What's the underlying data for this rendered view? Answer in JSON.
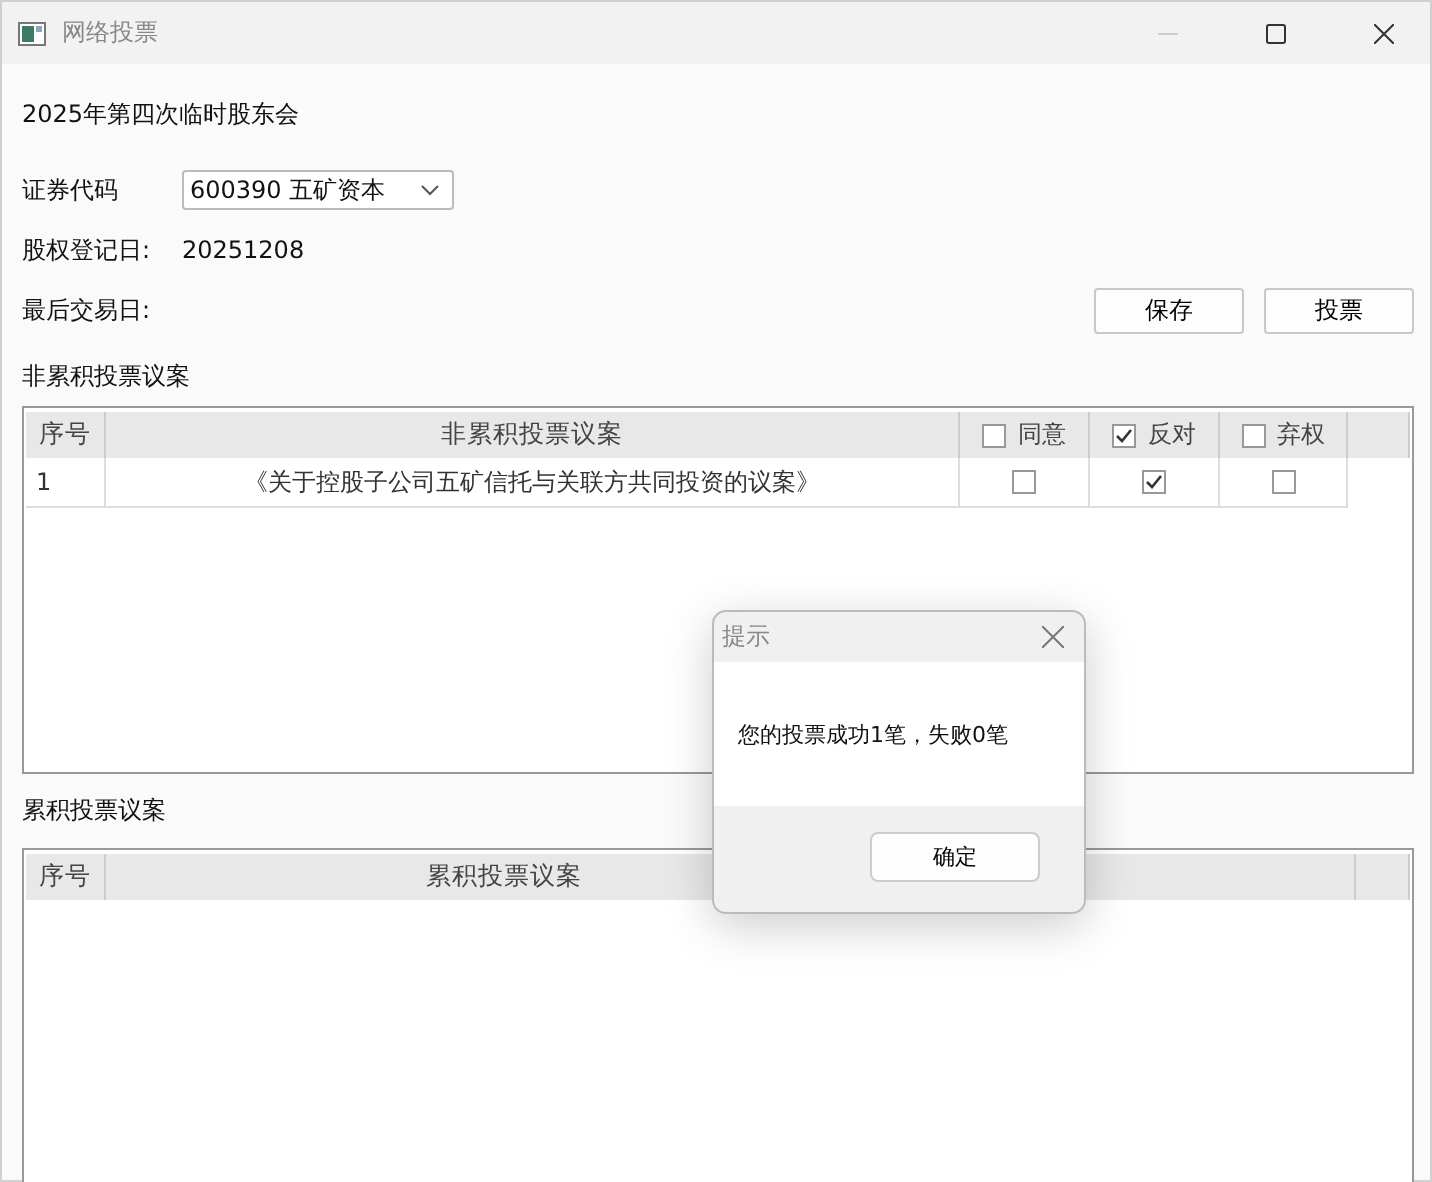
{
  "window": {
    "title": "网络投票"
  },
  "meeting_title": "2025年第四次临时股东会",
  "fields": [
    {
      "kind": "select",
      "label": "证券代码",
      "value": "600390 五矿资本"
    },
    {
      "kind": "text",
      "label": "股权登记日:",
      "value": "20251208"
    },
    {
      "kind": "text",
      "label": "最后交易日:"
    }
  ],
  "buttons": [
    "保存",
    "投票"
  ],
  "non_cumulative": {
    "title": "非累积投票议案",
    "columns": [
      {
        "kind": "text",
        "label": "序号"
      },
      {
        "kind": "text",
        "label": "非累积投票议案"
      },
      {
        "kind": "check",
        "label": "同意",
        "checked": false
      },
      {
        "kind": "check",
        "label": "反对",
        "checked": true
      },
      {
        "kind": "check",
        "label": "弃权",
        "checked": false
      }
    ],
    "rows": [
      {
        "number": "1",
        "proposal": "《关于控股子公司五矿信托与关联方共同投资的议案》",
        "votes": [
          {
            "checked": false
          },
          {
            "checked": true
          },
          {
            "checked": false
          }
        ]
      }
    ]
  },
  "cumulative": {
    "title": "累积投票议案",
    "columns": [
      {
        "kind": "text",
        "label": "序号"
      },
      {
        "kind": "text",
        "label": "累积投票议案"
      }
    ]
  },
  "dialog": {
    "title": "提示",
    "message": "您的投票成功1笔，失败0笔",
    "button": "确定"
  }
}
